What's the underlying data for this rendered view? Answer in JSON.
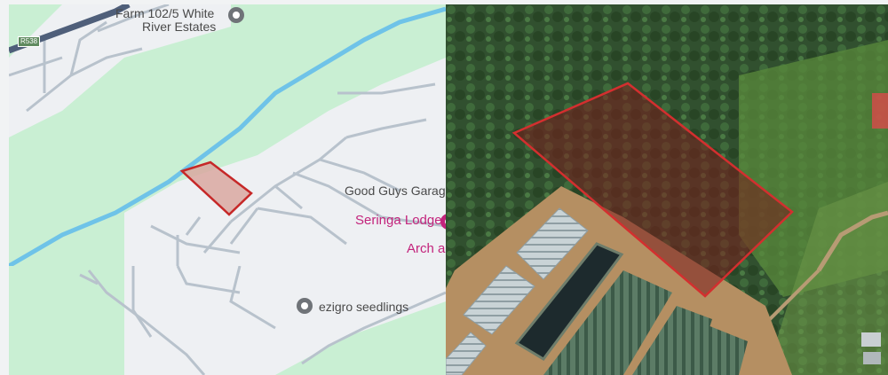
{
  "map": {
    "road_shield": "R538",
    "labels": {
      "farm_line1": "Farm 102/5 White",
      "farm_line2": "River Estates",
      "good_guys": "Good Guys Garag",
      "seringa": "Seringa Lodge",
      "arch": "Arch ar",
      "ezigro": "ezigro seedlings"
    },
    "icons": [
      "map-pin-icon",
      "map-pin-icon",
      "pink-pin-icon"
    ]
  },
  "colors": {
    "map_green": "#c9efd3",
    "map_gray_area": "#eef0f3",
    "river": "#6fc3e8",
    "road": "#b8c2cc",
    "highway": "#4f5f7a",
    "plot_outline": "#c62828",
    "plot_fill": "#d9a8a0",
    "pink_label": "#c3247c"
  }
}
